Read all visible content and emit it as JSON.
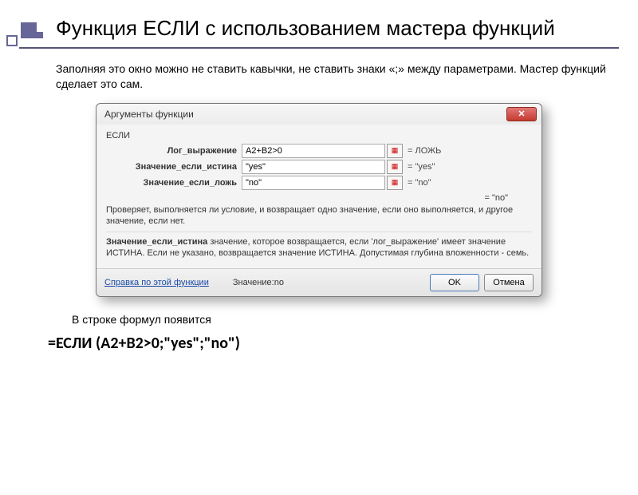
{
  "slide": {
    "title": "Функция ЕСЛИ с использованием мастера функций",
    "description": "Заполняя это окно можно не ставить кавычки, не ставить знаки «;» между параметрами. Мастер функций сделает это сам.",
    "after_text": "В строке формул появится",
    "formula": "=ЕСЛИ (A2+B2>0;\"yes\";\"no\")"
  },
  "dialog": {
    "title": "Аргументы функции",
    "func_name": "ЕСЛИ",
    "args": [
      {
        "label": "Лог_выражение",
        "value": "A2+B2>0",
        "eval": "= ЛОЖЬ"
      },
      {
        "label": "Значение_если_истина",
        "value": "\"yes\"",
        "eval": "= \"yes\""
      },
      {
        "label": "Значение_если_ложь",
        "value": "\"no\"",
        "eval": "= \"no\""
      }
    ],
    "result_preview": "= \"no\"",
    "desc1": "Проверяет, выполняется ли условие, и возвращает одно значение, если оно выполняется, и другое значение, если нет.",
    "desc_param_name": "Значение_если_истина",
    "desc_param_text": " значение, которое возвращается, если 'лог_выражение' имеет значение ИСТИНА. Если не указано, возвращается значение ИСТИНА. Допустимая глубина вложенности - семь.",
    "help_link": "Справка по этой функции",
    "value_label": "Значение:",
    "value_result": "no",
    "ok": "OK",
    "cancel": "Отмена",
    "close_glyph": "✕"
  }
}
